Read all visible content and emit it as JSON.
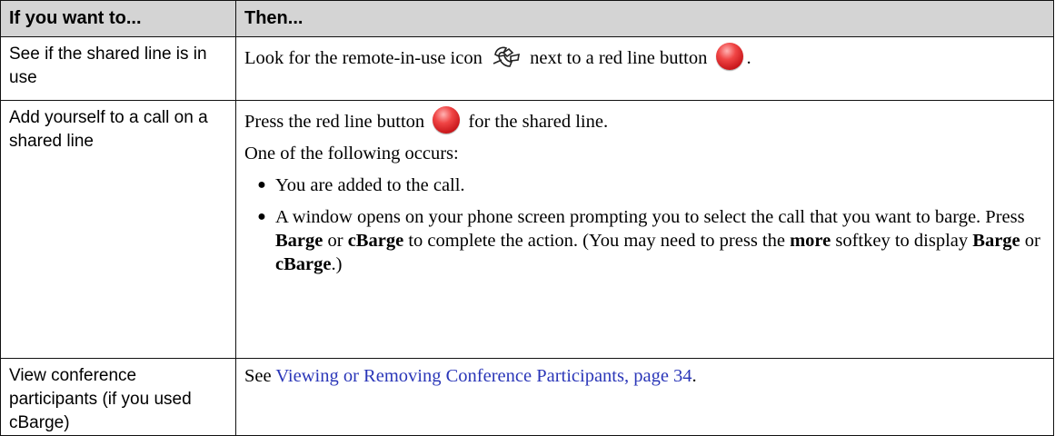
{
  "header": {
    "col1": "If you want to...",
    "col2": "Then..."
  },
  "rows": [
    {
      "action": "See if the shared line is in use",
      "then": {
        "before": "Look for the remote-in-use icon",
        "middle": "next to a red line button",
        "after": "."
      }
    },
    {
      "action": "Add yourself to a call on a shared line",
      "then": {
        "p1_before": "Press the red line button",
        "p1_after": "for the shared line.",
        "p2": "One of the following occurs:",
        "bullet1": "You are added to the call.",
        "bullet2": {
          "t1": "A window opens on your phone screen prompting you to select the call that you want to barge. Press ",
          "b1": "Barge",
          "t2": " or ",
          "b2": "cBarge",
          "t3": " to complete the action. (You may need to press the ",
          "b3": "more",
          "t4": " softkey to display ",
          "b4": "Barge",
          "t5": " or ",
          "b5": "cBarge",
          "t6": ".)"
        }
      }
    },
    {
      "action": "View conference participants (if you used cBarge)",
      "then": {
        "before": "See ",
        "link": "Viewing or Removing Conference Participants, page 34",
        "after": "."
      }
    }
  ],
  "icons": {
    "remote_in_use": "remote-in-use-icon",
    "line_button": "red-line-button-icon"
  },
  "colors": {
    "header_bg": "#d4d4d4",
    "link": "#2a36b8",
    "line_button": "#d42025"
  }
}
